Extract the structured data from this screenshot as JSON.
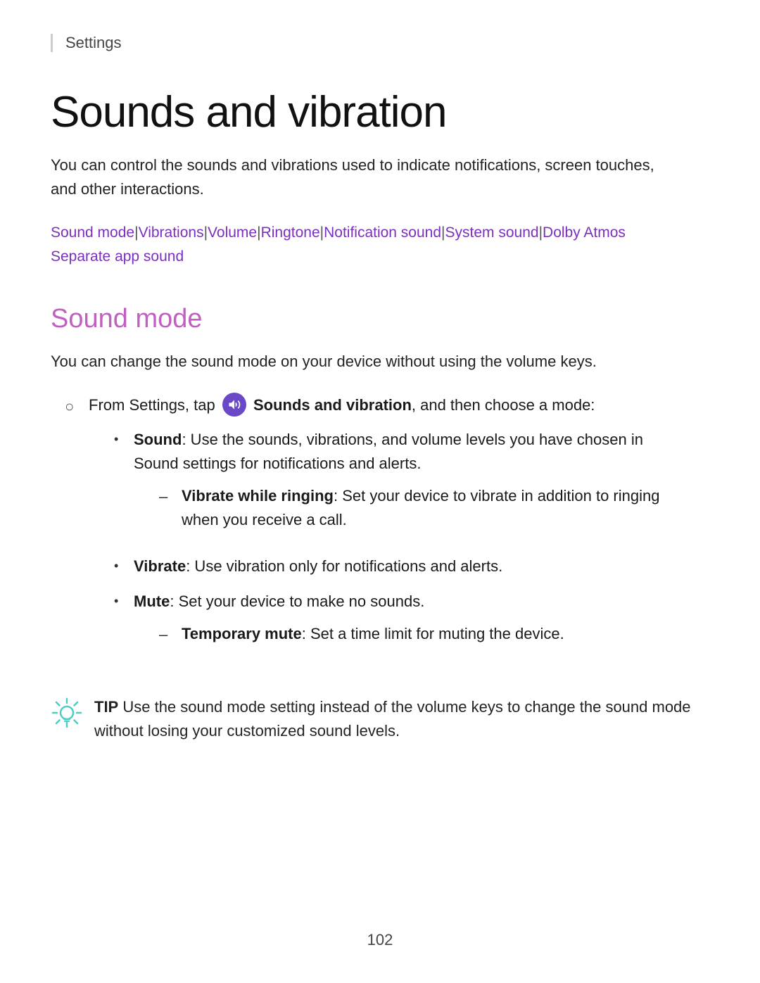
{
  "header": {
    "settings_label": "Settings"
  },
  "page": {
    "title": "Sounds and vibration",
    "intro": "You can control the sounds and vibrations used to indicate notifications, screen touches, and other interactions.",
    "page_number": "102"
  },
  "nav_links": {
    "items": [
      {
        "label": "Sound mode",
        "separator": true
      },
      {
        "label": "Vibrations",
        "separator": true
      },
      {
        "label": "Volume",
        "separator": true
      },
      {
        "label": "Ringtone",
        "separator": true
      },
      {
        "label": "Notification sound",
        "separator": true
      },
      {
        "label": "System sound",
        "separator": true
      },
      {
        "label": "Dolby Atmos",
        "separator": true
      },
      {
        "label": "Separate app sound",
        "separator": false
      }
    ]
  },
  "sound_mode_section": {
    "heading": "Sound mode",
    "description": "You can change the sound mode on your device without using the volume keys.",
    "from_settings_prefix": "From Settings, tap ",
    "from_settings_app": "Sounds and vibration",
    "from_settings_suffix": ", and then choose a mode:",
    "modes": [
      {
        "name": "Sound",
        "colon": ":",
        "description": " Use the sounds, vibrations, and volume levels you have chosen in Sound settings for notifications and alerts.",
        "sub_items": [
          {
            "name": "Vibrate while ringing",
            "colon": ":",
            "description": " Set your device to vibrate in addition to ringing when you receive a call."
          }
        ]
      },
      {
        "name": "Vibrate",
        "colon": ":",
        "description": " Use vibration only for notifications and alerts.",
        "sub_items": []
      },
      {
        "name": "Mute",
        "colon": ":",
        "description": " Set your device to make no sounds.",
        "sub_items": [
          {
            "name": "Temporary mute",
            "colon": ":",
            "description": " Set a time limit for muting the device."
          }
        ]
      }
    ]
  },
  "tip": {
    "label": "TIP",
    "text": " Use the sound mode setting instead of the volume keys to change the sound mode without losing your customized sound levels."
  }
}
